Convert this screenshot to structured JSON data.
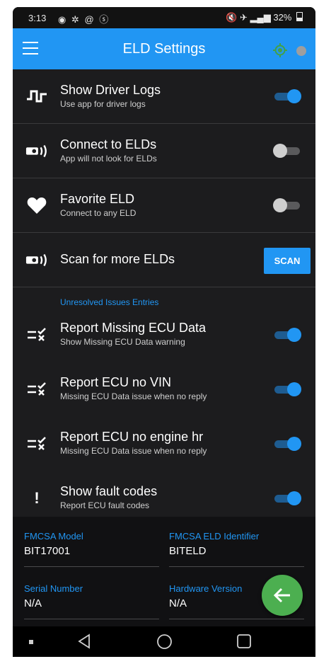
{
  "status_bar": {
    "time": "3:13",
    "left_icons": "◉ ✲ @ ⓢ",
    "right_icons": "🔇 ✈ ▂▄▆",
    "battery": "32%"
  },
  "app_bar": {
    "title": "ELD Settings",
    "color": "#2196f3"
  },
  "settings": [
    {
      "title": "Show Driver Logs",
      "subtitle": "Use app for driver logs",
      "icon": "pulse-icon",
      "toggle": "on"
    },
    {
      "title": "Connect to ELDs",
      "subtitle": "App will not look for ELDs",
      "icon": "eld-signal-icon",
      "toggle": "off"
    },
    {
      "title": "Favorite ELD",
      "subtitle": "Connect to any ELD",
      "icon": "heart-icon",
      "toggle": "off"
    },
    {
      "title": "Scan for more ELDs",
      "icon": "eld-signal-icon",
      "button": "SCAN"
    }
  ],
  "section_label": "Unresolved Issues Entries",
  "issues": [
    {
      "title": "Report Missing ECU Data",
      "subtitle": "Show Missing ECU Data warning",
      "icon": "check-x-list-icon",
      "toggle": "on"
    },
    {
      "title": "Report ECU no VIN",
      "subtitle": "Missing ECU Data issue when no reply",
      "icon": "check-x-list-icon",
      "toggle": "on"
    },
    {
      "title": "Report ECU no engine hr",
      "subtitle": "Missing ECU Data issue when no reply",
      "icon": "check-x-list-icon",
      "toggle": "on"
    },
    {
      "title": "Show fault codes",
      "subtitle": "Report ECU fault codes",
      "icon": "exclamation-icon",
      "icon_text": "!",
      "toggle": "on"
    }
  ],
  "info_fields": [
    {
      "label": "FMCSA Model",
      "value": "BIT17001"
    },
    {
      "label": "FMCSA ELD Identifier",
      "value": "BITELD"
    },
    {
      "label": "Serial Number",
      "value": "N/A"
    },
    {
      "label": "Hardware Version",
      "value": "N/A"
    }
  ],
  "fab": {
    "icon": "arrow-left-icon",
    "color": "#4caf50"
  },
  "nav_bar": [
    "square-dot-icon",
    "back-triangle-icon",
    "home-circle-icon",
    "recents-square-icon"
  ]
}
